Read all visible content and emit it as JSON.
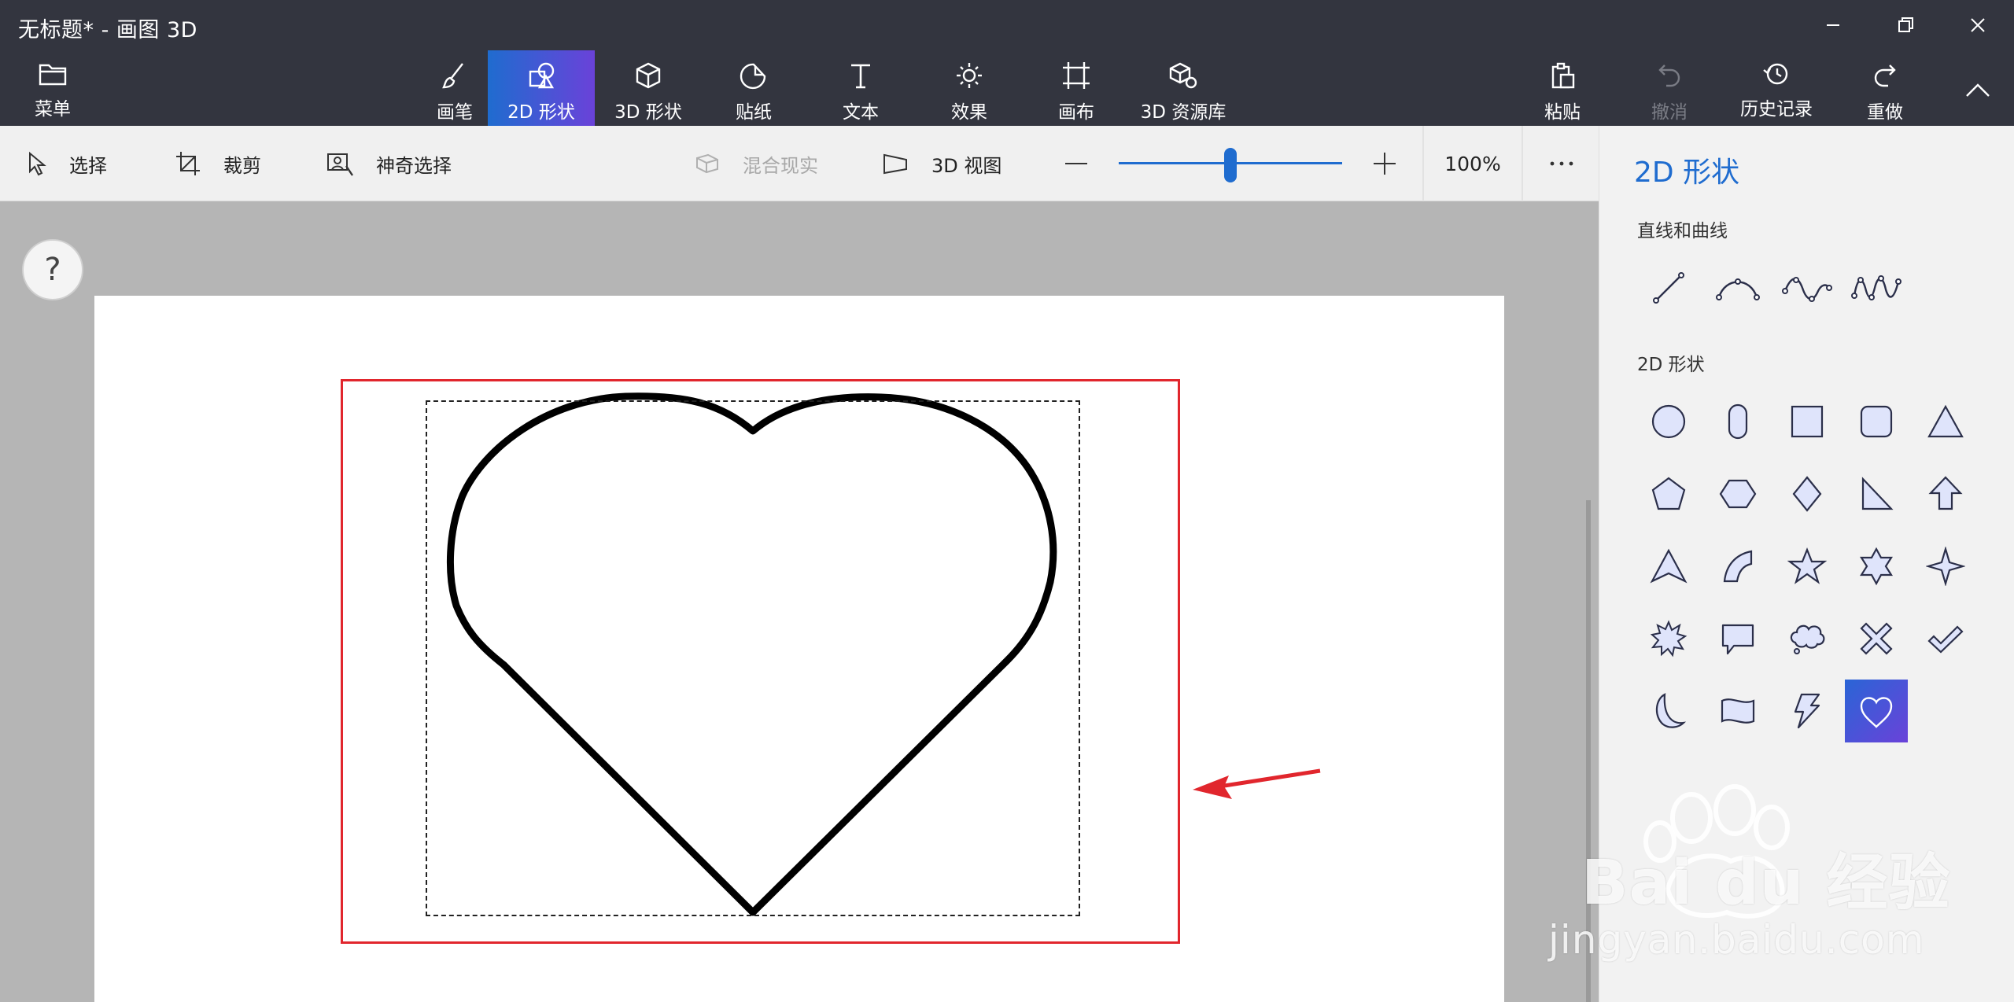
{
  "window": {
    "title": "无标题* - 画图 3D"
  },
  "toolbar": {
    "menu_label": "菜单",
    "tools": [
      {
        "label": "画笔",
        "icon": "brush-icon"
      },
      {
        "label": "2D 形状",
        "icon": "2d-shapes-icon",
        "active": true
      },
      {
        "label": "3D 形状",
        "icon": "3d-cube-icon"
      },
      {
        "label": "贴纸",
        "icon": "sticker-icon"
      },
      {
        "label": "文本",
        "icon": "text-icon"
      },
      {
        "label": "效果",
        "icon": "effects-sun-icon"
      },
      {
        "label": "画布",
        "icon": "canvas-crop-icon"
      },
      {
        "label": "3D 资源库",
        "icon": "3d-library-icon"
      }
    ],
    "actions": [
      {
        "label": "粘贴",
        "icon": "paste-icon"
      },
      {
        "label": "撤消",
        "icon": "undo-icon",
        "disabled": true
      },
      {
        "label": "历史记录",
        "icon": "history-icon"
      },
      {
        "label": "重做",
        "icon": "redo-icon"
      }
    ]
  },
  "subbar": {
    "select_label": "选择",
    "crop_label": "裁剪",
    "magic_select_label": "神奇选择",
    "mixed_reality_label": "混合现实",
    "view3d_label": "3D 视图",
    "zoom_value": "100%",
    "zoom_level": 0.5
  },
  "panel": {
    "title": "2D 形状",
    "lines_title": "直线和曲线",
    "shapes_title": "2D 形状",
    "lines": [
      "line",
      "curve-1",
      "curve-2",
      "curve-3"
    ],
    "shapes": [
      "circle",
      "rounded-pill",
      "square",
      "rounded-square",
      "triangle",
      "pentagon",
      "hexagon",
      "diamond",
      "right-triangle",
      "up-arrow",
      "arrowhead",
      "quarter-circle",
      "star-5",
      "star-6",
      "star-4",
      "burst",
      "speech-bubble",
      "thought-bubble",
      "x-mark",
      "check-mark",
      "crescent",
      "wave-banner",
      "lightning",
      "heart"
    ],
    "selected_shape": "heart"
  },
  "canvas": {
    "help_label": "?"
  },
  "colors": {
    "accent": "#1f6ccf",
    "accent2": "#6a42d9",
    "annotation": "#e1262d",
    "dark_bar": "#33353f"
  },
  "watermark": {
    "text": "Bai du 经验",
    "url": "jingyan.baidu.com"
  }
}
